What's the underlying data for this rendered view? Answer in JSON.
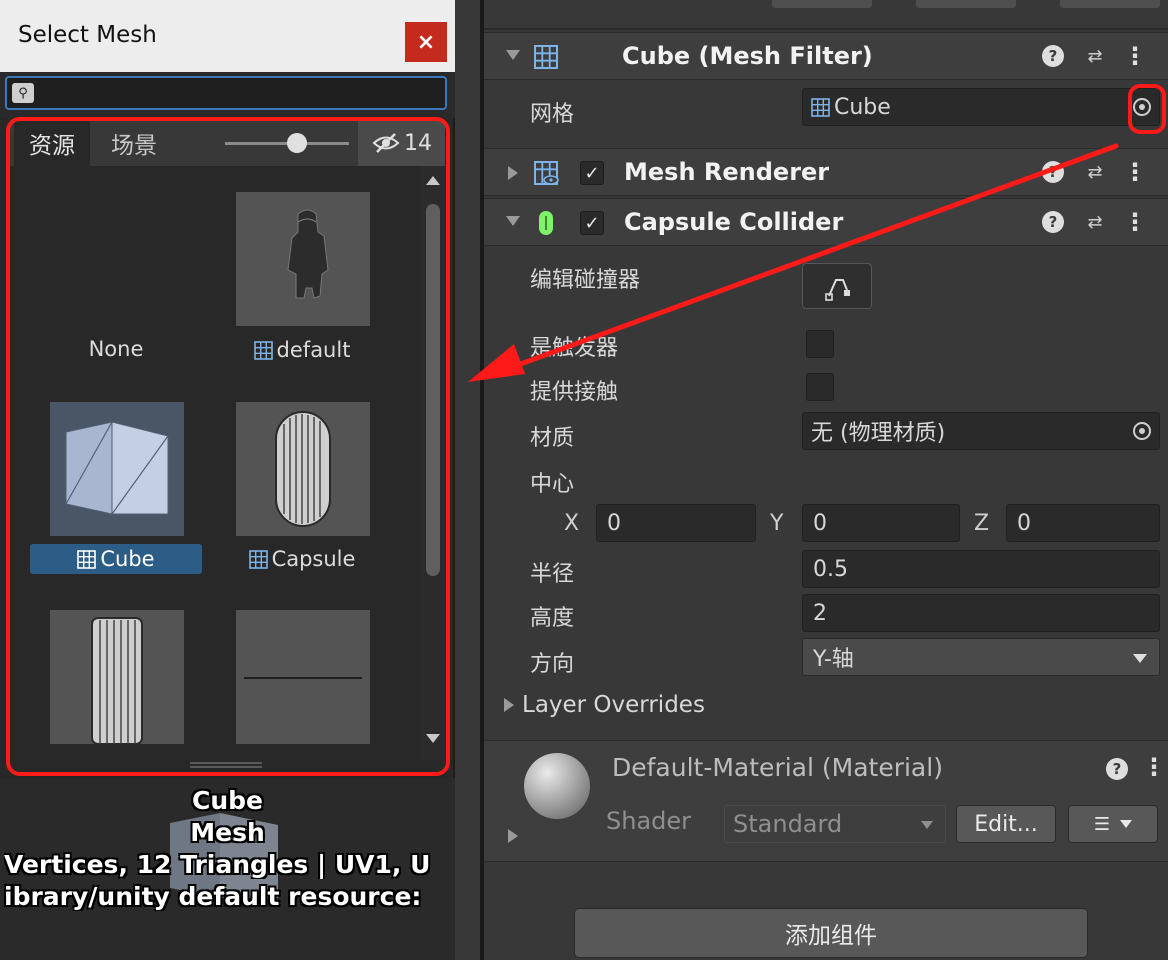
{
  "picker": {
    "title": "Select Mesh",
    "close_label": "×",
    "search": {
      "value": "",
      "placeholder": ""
    },
    "tabs": [
      {
        "label": "资源"
      },
      {
        "label": "场景"
      }
    ],
    "hidden_count": "14",
    "items": [
      {
        "name": "None",
        "selected": false
      },
      {
        "name": "default",
        "selected": false
      },
      {
        "name": "Cube",
        "selected": true
      },
      {
        "name": "Capsule",
        "selected": false
      },
      {
        "name": "",
        "selected": false
      },
      {
        "name": "",
        "selected": false
      }
    ],
    "preview": {
      "name": "Cube",
      "type": "Mesh",
      "info": "Vertices, 12 Triangles | UV1, U",
      "path": "ibrary/unity default resource:"
    }
  },
  "inspector": {
    "mesh_filter": {
      "title": "Cube (Mesh Filter)",
      "mesh_label": "网格",
      "mesh_value": "Cube"
    },
    "mesh_renderer": {
      "title": "Mesh Renderer",
      "enabled": true
    },
    "capsule_collider": {
      "title": "Capsule Collider",
      "enabled": true,
      "edit_collider_label": "编辑碰撞器",
      "is_trigger_label": "是触发器",
      "provides_contacts_label": "提供接触",
      "material_label": "材质",
      "material_value": "无 (物理材质)",
      "center_label": "中心",
      "center": {
        "x_label": "X",
        "x": "0",
        "y_label": "Y",
        "y": "0",
        "z_label": "Z",
        "z": "0"
      },
      "radius_label": "半径",
      "radius": "0.5",
      "height_label": "高度",
      "height": "2",
      "direction_label": "方向",
      "direction": "Y-轴",
      "layer_overrides_label": "Layer Overrides"
    },
    "material": {
      "title": "Default-Material (Material)",
      "shader_label": "Shader",
      "shader_value": "Standard",
      "edit_label": "Edit..."
    },
    "add_component_label": "添加组件"
  },
  "colors": {
    "annotation_red": "#ff1a1a",
    "selection_blue": "#2c5d87",
    "search_focus": "#3a79bb",
    "close_red": "#c42b1c"
  },
  "icons": [
    "search-icon",
    "close-icon",
    "eye-hidden-icon",
    "mesh-icon",
    "mesh-filter-icon",
    "mesh-renderer-icon",
    "capsule-collider-icon",
    "help-icon",
    "preset-icon",
    "kebab-menu-icon",
    "object-picker-icon",
    "edit-collider-icon",
    "dropdown-icon",
    "list-icon"
  ]
}
